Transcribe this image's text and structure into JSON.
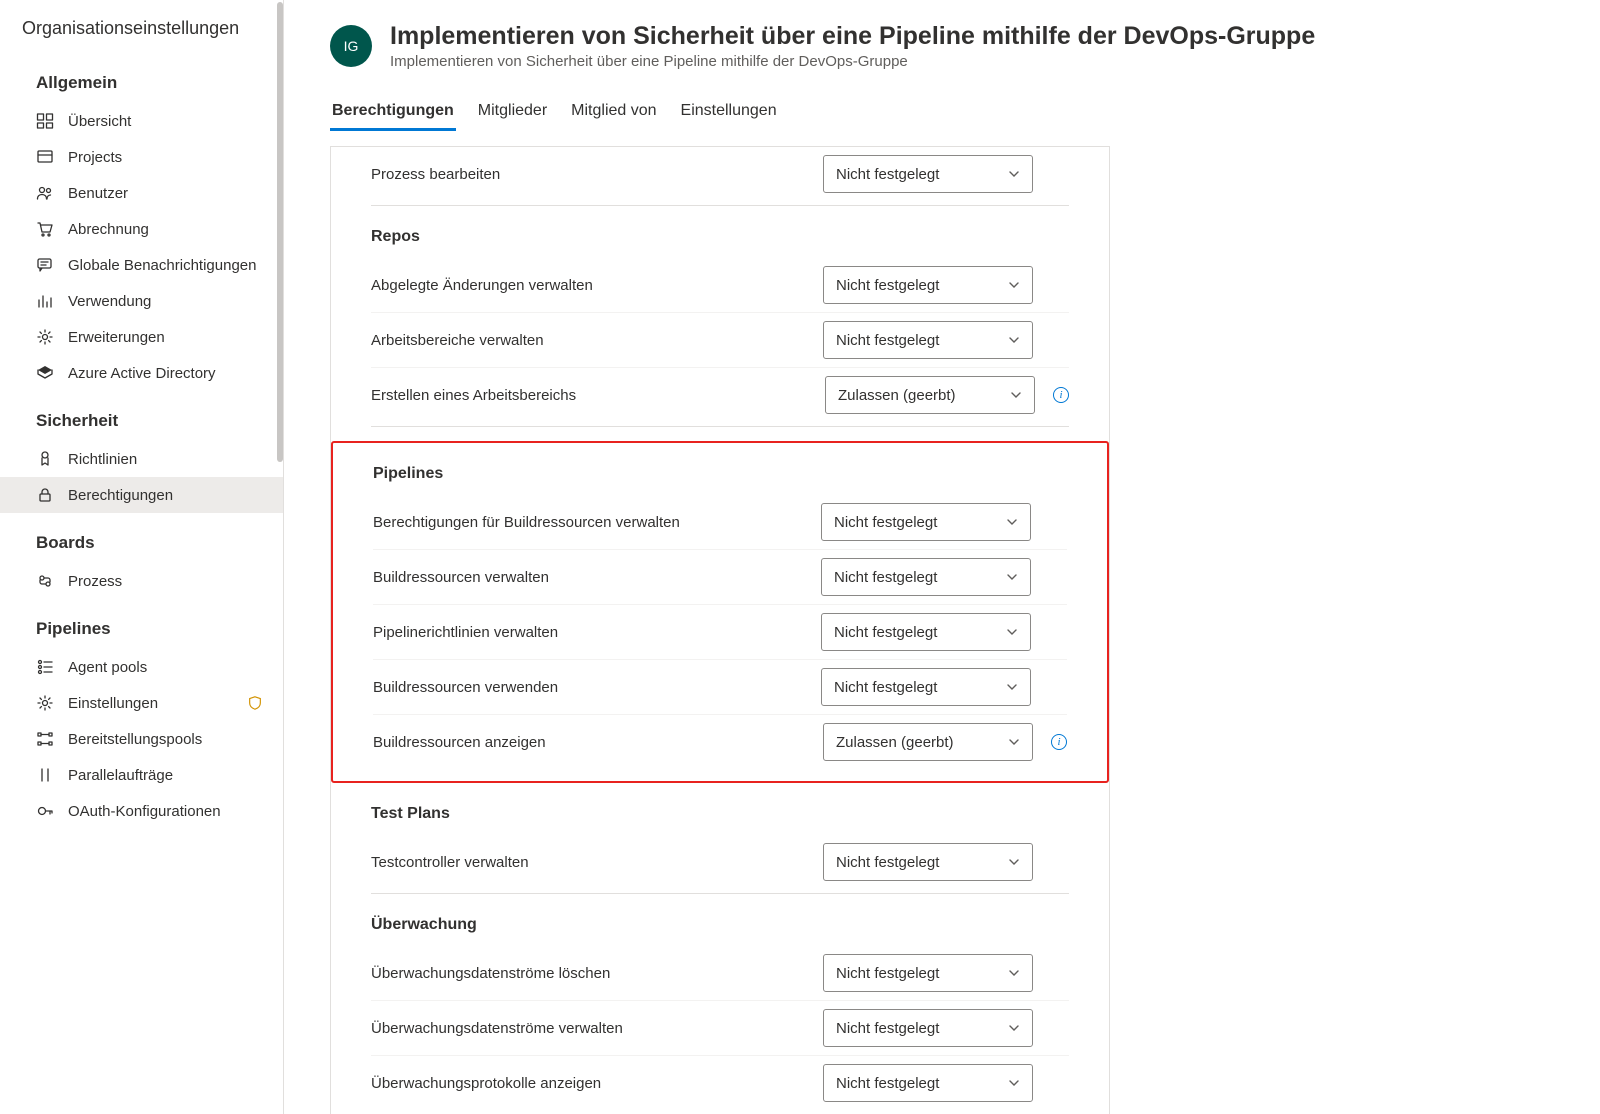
{
  "sidebar": {
    "title": "Organisationseinstellungen",
    "sections": [
      {
        "heading": "Allgemein",
        "items": [
          {
            "label": "Übersicht",
            "icon": "summary"
          },
          {
            "label": "Projects",
            "icon": "projects"
          },
          {
            "label": "Benutzer",
            "icon": "users"
          },
          {
            "label": "Abrechnung",
            "icon": "cart"
          },
          {
            "label": "Globale Benachrichtigungen",
            "icon": "chat"
          },
          {
            "label": "Verwendung",
            "icon": "usage"
          },
          {
            "label": "Erweiterungen",
            "icon": "gear"
          },
          {
            "label": "Azure Active Directory",
            "icon": "aad"
          }
        ]
      },
      {
        "heading": "Sicherheit",
        "items": [
          {
            "label": "Richtlinien",
            "icon": "policy"
          },
          {
            "label": "Berechtigungen",
            "icon": "lock",
            "active": true
          }
        ]
      },
      {
        "heading": "Boards",
        "items": [
          {
            "label": "Prozess",
            "icon": "process"
          }
        ]
      },
      {
        "heading": "Pipelines",
        "items": [
          {
            "label": "Agent pools",
            "icon": "agentpools"
          },
          {
            "label": "Einstellungen",
            "icon": "gear2",
            "badge": true
          },
          {
            "label": "Bereitstellungspools",
            "icon": "deploy"
          },
          {
            "label": "Parallelaufträge",
            "icon": "parallel"
          },
          {
            "label": "OAuth-Konfigurationen",
            "icon": "oauth"
          }
        ]
      }
    ]
  },
  "header": {
    "avatar": "IG",
    "title": "Implementieren von Sicherheit über eine Pipeline mithilfe der DevOps-Gruppe",
    "subtitle": "Implementieren von Sicherheit über eine Pipeline mithilfe der DevOps-Gruppe"
  },
  "tabs": [
    "Berechtigungen",
    "Mitglieder",
    "Mitglied von",
    "Einstellungen"
  ],
  "activeTab": 0,
  "permissions": {
    "lead": {
      "label": "Prozess bearbeiten",
      "value": "Nicht festgelegt"
    },
    "sections": [
      {
        "title": "Repos",
        "rows": [
          {
            "label": "Abgelegte Änderungen verwalten",
            "value": "Nicht festgelegt"
          },
          {
            "label": "Arbeitsbereiche verwalten",
            "value": "Nicht festgelegt"
          },
          {
            "label": "Erstellen eines Arbeitsbereichs",
            "value": "Zulassen (geerbt)",
            "info": true
          }
        ]
      },
      {
        "title": "Pipelines",
        "highlight": true,
        "rows": [
          {
            "label": "Berechtigungen für Buildressourcen verwalten",
            "value": "Nicht festgelegt"
          },
          {
            "label": "Buildressourcen verwalten",
            "value": "Nicht festgelegt"
          },
          {
            "label": "Pipelinerichtlinien verwalten",
            "value": "Nicht festgelegt"
          },
          {
            "label": "Buildressourcen verwenden",
            "value": "Nicht festgelegt"
          },
          {
            "label": "Buildressourcen anzeigen",
            "value": "Zulassen (geerbt)",
            "info": true
          }
        ]
      },
      {
        "title": "Test Plans",
        "rows": [
          {
            "label": "Testcontroller verwalten",
            "value": "Nicht festgelegt"
          }
        ]
      },
      {
        "title": "Überwachung",
        "rows": [
          {
            "label": "Überwachungsdatenströme löschen",
            "value": "Nicht festgelegt"
          },
          {
            "label": "Überwachungsdatenströme verwalten",
            "value": "Nicht festgelegt"
          },
          {
            "label": "Überwachungsprotokolle anzeigen",
            "value": "Nicht festgelegt"
          }
        ]
      }
    ]
  }
}
